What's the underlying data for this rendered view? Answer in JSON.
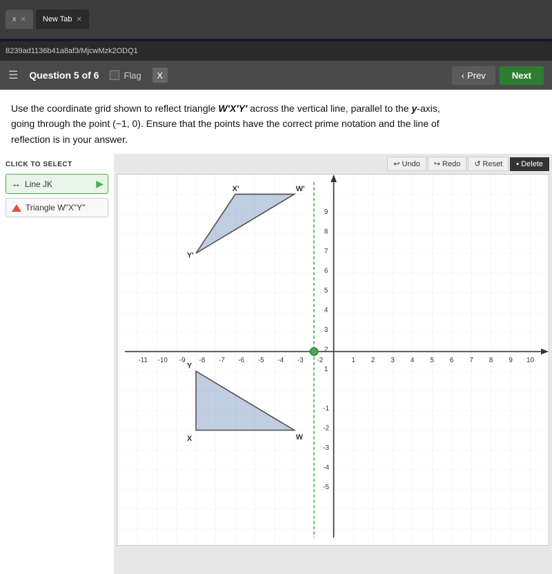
{
  "browser": {
    "url": "8239ad1136b41a8af3/MjcwMzk2ODQ1",
    "tabs": [
      {
        "label": "x",
        "active": false
      },
      {
        "label": "New Tab",
        "active": true
      }
    ]
  },
  "header": {
    "question_num": "Question 5 of 6",
    "flag_label": "Flag",
    "x_label": "X",
    "prev_label": "Prev",
    "next_label": "Next"
  },
  "question": {
    "text_line1": "Use the coordinate grid shown to reflect triangle W′X′Y′ across the vertical line, parallel to the y-axis,",
    "text_line2": "going through the point (−1,0).  Ensure that the points have the correct prime notation and the line of",
    "text_line3": "reflection is in your answer."
  },
  "sidebar": {
    "click_label": "CLICK TO SELECT",
    "items": [
      {
        "id": "line-jk",
        "label": "Line JK",
        "icon": "line-icon",
        "active": true
      },
      {
        "id": "triangle-wxy",
        "label": "Triangle W\"X\"Y\"",
        "icon": "triangle-icon",
        "active": false
      }
    ]
  },
  "toolbar": {
    "undo": "Undo",
    "redo": "Redo",
    "reset": "Reset",
    "delete": "Delete"
  },
  "graph": {
    "x_min": -11,
    "x_max": 10,
    "y_min": -5,
    "y_max": 9
  }
}
